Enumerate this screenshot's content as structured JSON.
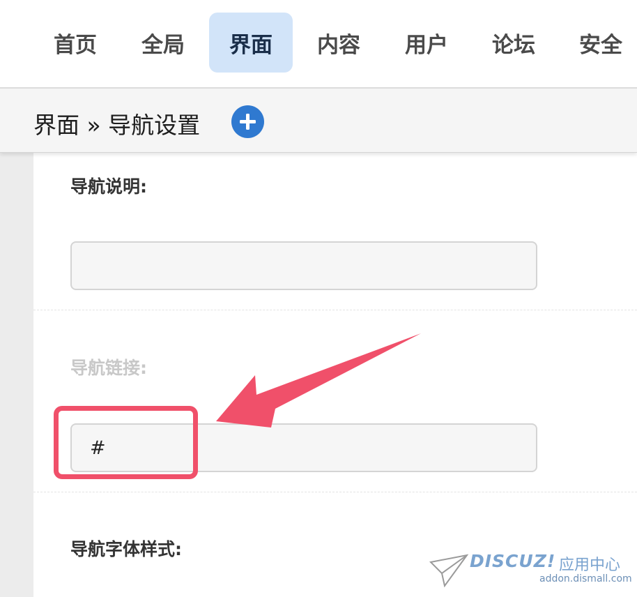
{
  "topnav": {
    "tabs": [
      {
        "label": "首页",
        "active": false
      },
      {
        "label": "全局",
        "active": false
      },
      {
        "label": "界面",
        "active": true
      },
      {
        "label": "内容",
        "active": false
      },
      {
        "label": "用户",
        "active": false
      },
      {
        "label": "论坛",
        "active": false
      },
      {
        "label": "安全",
        "active": false
      }
    ]
  },
  "breadcrumb": {
    "text": "界面 » 导航设置",
    "add_icon": "plus-circle-icon"
  },
  "form": {
    "nav_description": {
      "label": "导航说明:",
      "value": ""
    },
    "nav_link": {
      "label": "导航链接:",
      "value": "#"
    },
    "nav_font_style": {
      "label": "导航字体样式:"
    }
  },
  "annotation": {
    "color": "#f0506a",
    "arrow_icon": "annotation-arrow-icon"
  },
  "watermark": {
    "brand": "DISCUZ!",
    "brand_cn": "应用中心",
    "url": "addon.dismall.com",
    "icon": "paper-plane-icon"
  },
  "colors": {
    "active_tab_bg": "#d2e4f9",
    "add_button": "#2f79d0",
    "highlight": "#f0506a"
  }
}
